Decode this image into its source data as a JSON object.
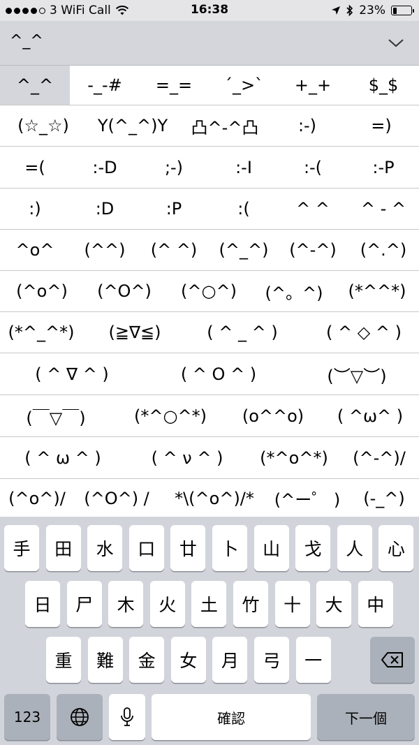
{
  "status_bar": {
    "carrier": "3 WiFi Call",
    "time": "16:38",
    "battery": "23%",
    "battery_level": 0.23,
    "icons": [
      "signal-dots",
      "wifi-icon",
      "location-icon",
      "bluetooth-icon",
      "battery-icon"
    ]
  },
  "candidate_header": {
    "preedit": "^_^",
    "collapse_icon": "chevron-down-icon"
  },
  "candidates": [
    [
      "^_^",
      "-_-#",
      "=_=",
      "´_>`",
      "+_+",
      "$_$"
    ],
    [
      "(☆_☆)",
      "Y(^_^)Y",
      "凸^-^凸",
      ":-)",
      "=)"
    ],
    [
      "=(",
      ":-D",
      ";-)",
      ":-I",
      ":-(",
      ":-P"
    ],
    [
      ":)",
      ":D",
      ":P",
      ":(",
      "^ ^",
      "^ - ^"
    ],
    [
      "^o^",
      "(^^)",
      "(^ ^)",
      "(^_^)",
      "(^-^)",
      "(^.^)"
    ],
    [
      "(^o^)",
      "(^O^)",
      "(^○^)",
      "(^。^)",
      "(*^^*)"
    ],
    [
      "(*^_^*)",
      "(≧∇≦)",
      "( ^ _ ^ )",
      "( ^ ◇ ^ )"
    ],
    [
      "( ^ ∇ ^ )",
      "( ^ O ^ )",
      "(︶▽︶)"
    ],
    [
      "(￣▽￣)",
      "(*^○^*)",
      "(o^^o)",
      "( ^ω^ )"
    ],
    [
      "( ^ ω ^ )",
      "( ^ ν ^ )",
      "(*^o^*)",
      "(^-^)/"
    ],
    [
      "(^o^)/",
      "(^O^) /",
      "*\\(^o^)/*",
      "(^ー゜ )",
      "(-_^)"
    ]
  ],
  "keyboard": {
    "row1": [
      "手",
      "田",
      "水",
      "口",
      "廿",
      "卜",
      "山",
      "戈",
      "人",
      "心"
    ],
    "row2": [
      "日",
      "尸",
      "木",
      "火",
      "土",
      "竹",
      "十",
      "大",
      "中"
    ],
    "row3": [
      "重",
      "難",
      "金",
      "女",
      "月",
      "弓",
      "一"
    ],
    "backspace_icon": "backspace-icon",
    "numbers_label": "123",
    "globe_icon": "globe-icon",
    "mic_icon": "microphone-icon",
    "confirm_label": "確認",
    "next_label": "下一個"
  }
}
